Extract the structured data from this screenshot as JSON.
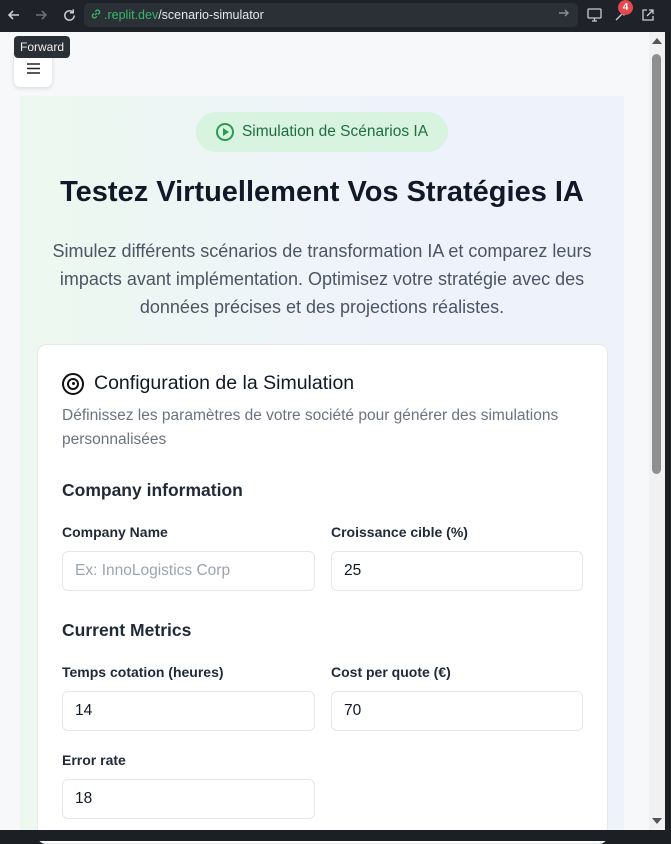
{
  "browser": {
    "url_domain": ".replit.dev",
    "url_path": "/scenario-simulator",
    "tooltip": "Forward",
    "badge_count": "4"
  },
  "hero": {
    "badge_label": "Simulation de Scénarios IA",
    "title": "Testez Virtuellement Vos Stratégies IA",
    "subtitle": "Simulez différents scénarios de transformation IA et comparez leurs impacts avant implémentation. Optimisez votre stratégie avec des données précises et des projections réalistes."
  },
  "card": {
    "title": "Configuration de la Simulation",
    "description": "Définissez les paramètres de votre société pour générer des simulations personnalisées",
    "company_section": "Company information",
    "metrics_section": "Current Metrics",
    "fields": {
      "company_name": {
        "label": "Company Name",
        "value": "",
        "placeholder": "Ex: InnoLogistics Corp"
      },
      "growth_target": {
        "label": "Croissance cible (%)",
        "value": "25"
      },
      "quote_time": {
        "label": "Temps cotation (heures)",
        "value": "14"
      },
      "cost_per_quote": {
        "label": "Cost per quote (€)",
        "value": "70"
      },
      "error_rate": {
        "label": "Error rate",
        "value": "18"
      }
    }
  },
  "colors": {
    "accent_green": "#2a9a54",
    "badge_red": "#e5484d"
  },
  "icons": {
    "back": "arrow-left-icon",
    "forward": "arrow-right-icon",
    "reload": "reload-icon",
    "menu": "hamburger-icon",
    "play": "play-circle-icon",
    "target": "target-icon"
  }
}
